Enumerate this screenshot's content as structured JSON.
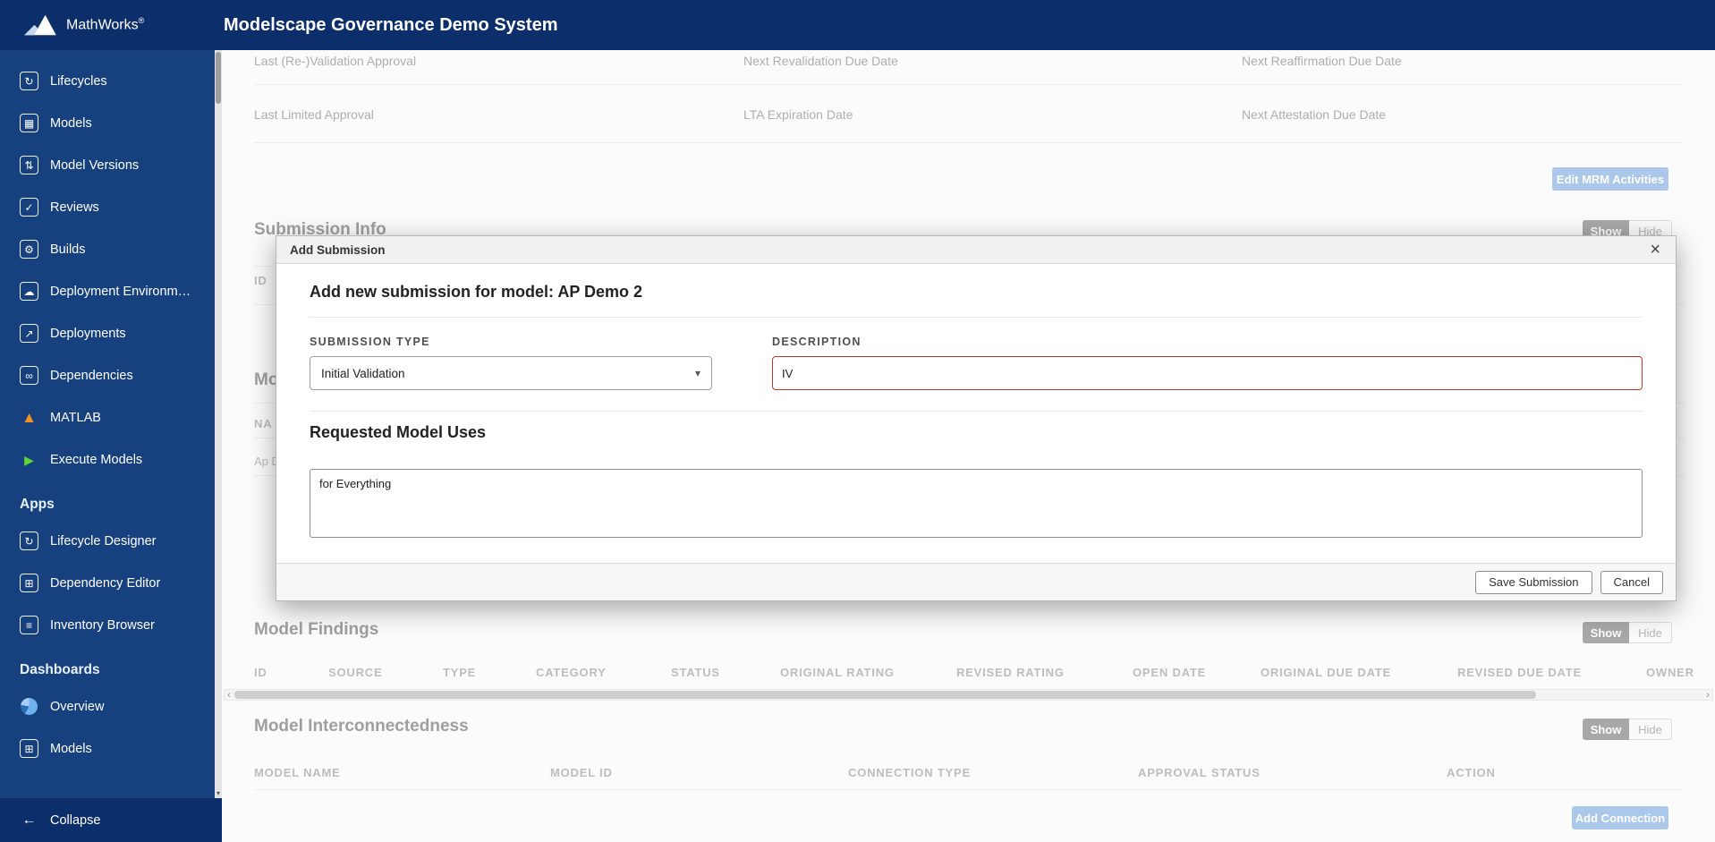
{
  "header": {
    "brand": "MathWorks",
    "registered": "®",
    "title": "Modelscape Governance Demo System"
  },
  "sidebar": {
    "items": [
      {
        "label": "Lifecycles"
      },
      {
        "label": "Models"
      },
      {
        "label": "Model Versions"
      },
      {
        "label": "Reviews"
      },
      {
        "label": "Builds"
      },
      {
        "label": "Deployment Environm…"
      },
      {
        "label": "Deployments"
      },
      {
        "label": "Dependencies"
      },
      {
        "label": "MATLAB"
      },
      {
        "label": "Execute Models"
      }
    ],
    "apps_heading": "Apps",
    "apps": [
      {
        "label": "Lifecycle Designer"
      },
      {
        "label": "Dependency Editor"
      },
      {
        "label": "Inventory Browser"
      }
    ],
    "dashboards_heading": "Dashboards",
    "dashboards": [
      {
        "label": "Overview"
      },
      {
        "label": "Models"
      }
    ],
    "collapse_label": "Collapse"
  },
  "icons": {
    "lifecycles": "↻",
    "models": "▦",
    "model_versions": "⇅",
    "reviews": "✓",
    "builds": "⚙",
    "deployment_environments": "☁",
    "deployments": "↗",
    "dependencies": "∞",
    "matlab": "▲",
    "execute_models": "▶",
    "lifecycle_designer": "↻",
    "dependency_editor": "⊞",
    "inventory_browser": "≡",
    "models_dashboard": "⊞",
    "collapse": "←",
    "close": "×",
    "select_caret": "▾",
    "scroll_left": "‹",
    "scroll_right": "›",
    "scroll_down": "▾"
  },
  "page": {
    "fields": [
      {
        "label": "Last (Re-)Validation Approval"
      },
      {
        "label": "Next Revalidation Due Date"
      },
      {
        "label": "Next Reaffirmation Due Date"
      },
      {
        "label": "Last Limited Approval"
      },
      {
        "label": "LTA Expiration Date"
      },
      {
        "label": "Next Attestation Due Date"
      }
    ],
    "edit_mrm_button": "Edit MRM Activities",
    "submission_info": {
      "heading": "Submission Info",
      "show": "Show",
      "hide": "Hide",
      "id_column": "ID"
    },
    "partial_heading": "Mo",
    "partial_column": "NA",
    "partial_value": "Ap D",
    "findings": {
      "heading": "Model Findings",
      "show": "Show",
      "hide": "Hide",
      "columns": [
        "ID",
        "SOURCE",
        "TYPE",
        "CATEGORY",
        "STATUS",
        "ORIGINAL RATING",
        "REVISED RATING",
        "OPEN DATE",
        "ORIGINAL DUE DATE",
        "REVISED DUE DATE",
        "OWNER"
      ]
    },
    "interconnectedness": {
      "heading": "Model Interconnectedness",
      "show": "Show",
      "hide": "Hide",
      "columns": [
        "MODEL NAME",
        "MODEL ID",
        "CONNECTION TYPE",
        "APPROVAL STATUS",
        "ACTION"
      ],
      "add_connection_button": "Add Connection"
    }
  },
  "modal": {
    "title": "Add Submission",
    "heading": "Add new submission for model: AP Demo 2",
    "submission_type": {
      "label": "SUBMISSION TYPE",
      "value": "Initial Validation"
    },
    "description": {
      "label": "DESCRIPTION",
      "value": "IV"
    },
    "requested_uses": {
      "heading": "Requested Model Uses",
      "value": "for Everything"
    },
    "save_button": "Save Submission",
    "cancel_button": "Cancel"
  },
  "colors": {
    "header_bg": "#0c2f6b",
    "sidebar_bg": "#16417e",
    "accent_dimmed": "#abc8ea",
    "error_border": "#c0392b"
  }
}
